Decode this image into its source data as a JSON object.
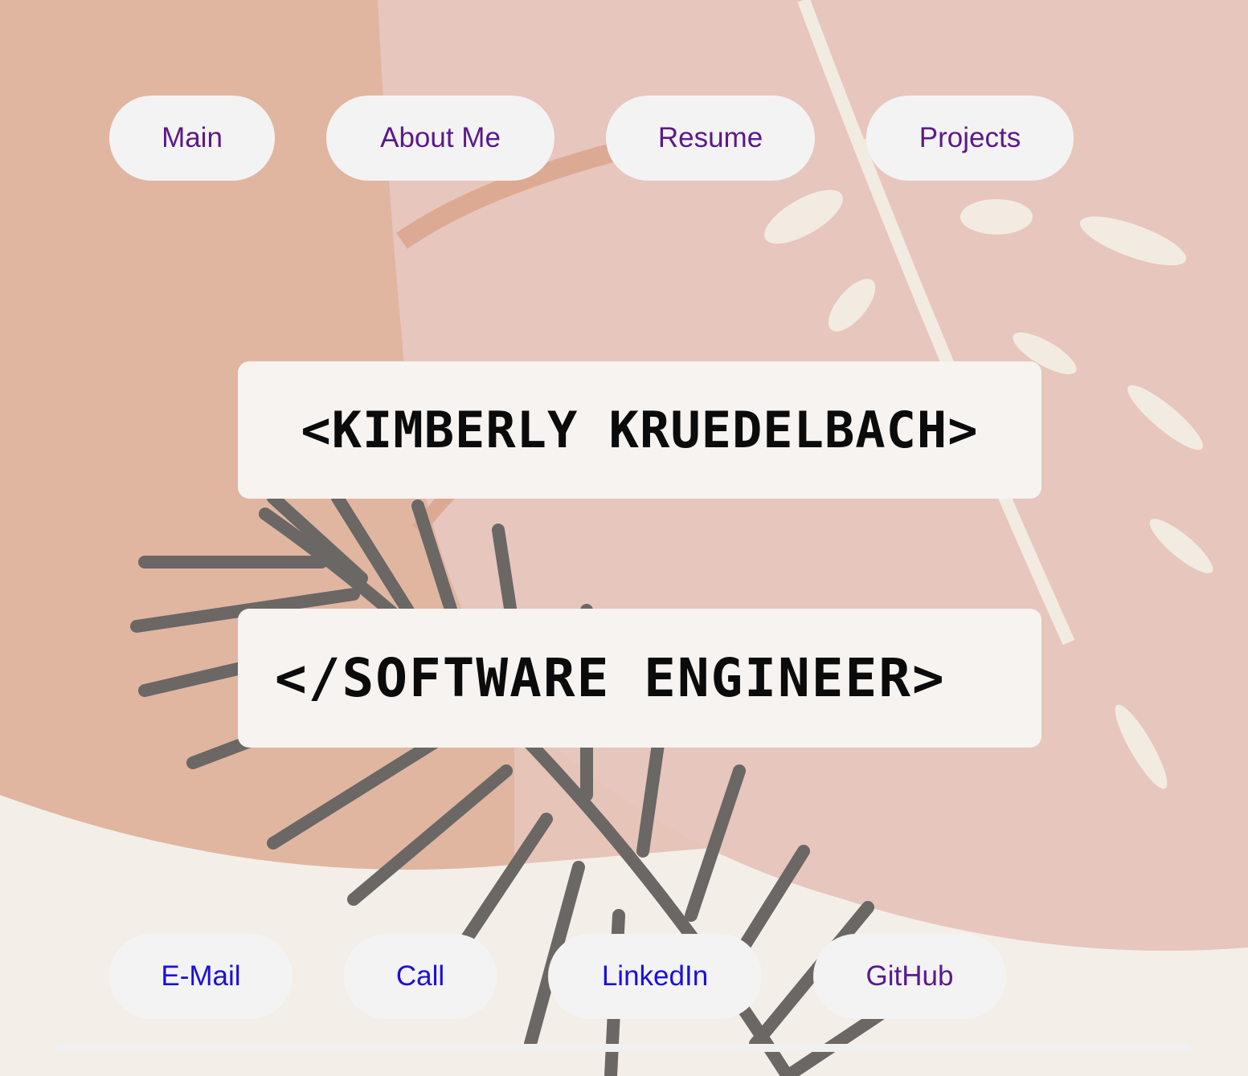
{
  "nav": {
    "items": [
      {
        "label": "Main"
      },
      {
        "label": "About Me"
      },
      {
        "label": "Resume"
      },
      {
        "label": "Projects"
      }
    ]
  },
  "hero": {
    "name": "<KIMBERLY KRUEDELBACH>",
    "role": "</SOFTWARE ENGINEER>"
  },
  "contact": {
    "items": [
      {
        "label": "E-Mail"
      },
      {
        "label": "Call"
      },
      {
        "label": "LinkedIn"
      },
      {
        "label": "GitHub"
      }
    ]
  },
  "colors": {
    "nav_text": "#5a1a8a",
    "link_text": "#1a10d8",
    "pill_bg": "#f4f3f3",
    "banner_bg": "#f6f3f1"
  }
}
